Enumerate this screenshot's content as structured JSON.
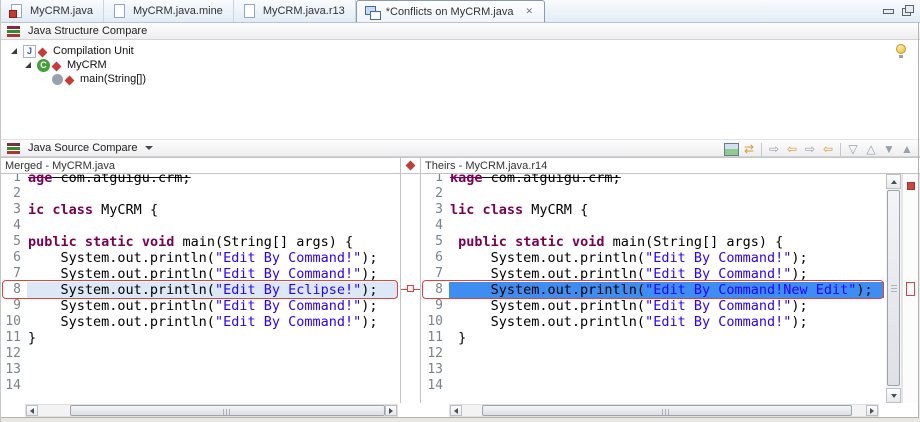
{
  "tabs": [
    {
      "label": "MyCRM.java",
      "icon": "java-file-error",
      "active": false
    },
    {
      "label": "MyCRM.java.mine",
      "icon": "file",
      "active": false
    },
    {
      "label": "MyCRM.java.r13",
      "icon": "file",
      "active": false
    },
    {
      "label": "*Conflicts on MyCRM.java",
      "icon": "compare-editor",
      "active": true,
      "close_glyph": "✕"
    }
  ],
  "structure_compare": {
    "title": "Java Structure Compare",
    "items": [
      {
        "label": "Compilation Unit",
        "icon": "java-cu",
        "glyph": "J",
        "level": 0,
        "expanded": true,
        "marker": "conflict"
      },
      {
        "label": "MyCRM",
        "icon": "class",
        "glyph": "C",
        "level": 1,
        "expanded": true,
        "marker": "conflict"
      },
      {
        "label": "main(String[])",
        "icon": "method",
        "glyph": "",
        "level": 2,
        "expanded": null,
        "marker": "conflict"
      }
    ]
  },
  "source_compare": {
    "title": "Java Source Compare",
    "toolbar": [
      {
        "name": "switch-compare-viewer",
        "glyph": "",
        "cls": "layout"
      },
      {
        "name": "swap-left-and-right",
        "glyph": "⇄",
        "cls": "gold"
      },
      {
        "sep": true
      },
      {
        "name": "copy-all-from-left-to-right",
        "glyph": "⇨",
        "cls": ""
      },
      {
        "name": "copy-all-non-conflicting-from-right-to-left",
        "glyph": "⇦",
        "cls": "gold"
      },
      {
        "name": "copy-current-change-from-left-to-right",
        "glyph": "⇨",
        "cls": ""
      },
      {
        "name": "copy-current-change-from-right-to-left",
        "glyph": "⇦",
        "cls": "gold"
      },
      {
        "sep": true
      },
      {
        "name": "next-difference",
        "glyph": "▽",
        "cls": ""
      },
      {
        "name": "previous-difference",
        "glyph": "△",
        "cls": ""
      },
      {
        "name": "next-change",
        "glyph": "▼",
        "cls": ""
      },
      {
        "name": "previous-change",
        "glyph": "▲",
        "cls": ""
      }
    ],
    "left": {
      "title": "Merged - MyCRM.java",
      "total_lines": 14,
      "lines": [
        {
          "strike": true,
          "segs": [
            [
              "age",
              "k"
            ],
            [
              " com.atguigu.crm;",
              "p"
            ]
          ]
        },
        {
          "segs": []
        },
        {
          "segs": [
            [
              "ic",
              "k"
            ],
            [
              " ",
              "p"
            ],
            [
              "class",
              "k"
            ],
            [
              " MyCRM {",
              "p"
            ]
          ]
        },
        {
          "segs": []
        },
        {
          "segs": [
            [
              "public",
              "k"
            ],
            [
              " ",
              "p"
            ],
            [
              "static",
              "k"
            ],
            [
              " ",
              "p"
            ],
            [
              "void",
              "k"
            ],
            [
              " main(String[] args) {",
              "p"
            ]
          ]
        },
        {
          "segs": [
            [
              "    System.out.println(",
              "p"
            ],
            [
              "\"Edit By Command!\"",
              "s"
            ],
            [
              ");",
              "p"
            ]
          ]
        },
        {
          "segs": [
            [
              "    System.out.println(",
              "p"
            ],
            [
              "\"Edit By Command!\"",
              "s"
            ],
            [
              ");",
              "p"
            ]
          ]
        },
        {
          "diff": true,
          "segs": [
            [
              "    System.out.println(",
              "p"
            ],
            [
              "\"Edit By Eclipse!\"",
              "s"
            ],
            [
              ");",
              "p"
            ]
          ]
        },
        {
          "segs": [
            [
              "    System.out.println(",
              "p"
            ],
            [
              "\"Edit By Command!\"",
              "s"
            ],
            [
              ");",
              "p"
            ]
          ]
        },
        {
          "segs": [
            [
              "    System.out.println(",
              "p"
            ],
            [
              "\"Edit By Command!\"",
              "s"
            ],
            [
              ");",
              "p"
            ]
          ]
        },
        {
          "segs": [
            [
              "}",
              "p"
            ]
          ]
        },
        {
          "segs": []
        },
        {
          "segs": []
        },
        {
          "segs": []
        }
      ]
    },
    "right": {
      "title": "Theirs - MyCRM.java.r14",
      "total_lines": 14,
      "lines": [
        {
          "strike": true,
          "segs": [
            [
              "kage",
              "k"
            ],
            [
              " com.atguigu.crm;",
              "p"
            ]
          ]
        },
        {
          "segs": []
        },
        {
          "segs": [
            [
              "lic",
              "k"
            ],
            [
              " ",
              "p"
            ],
            [
              "class",
              "k"
            ],
            [
              " MyCRM {",
              "p"
            ]
          ]
        },
        {
          "segs": []
        },
        {
          "segs": [
            [
              " ",
              "p"
            ],
            [
              "public",
              "k"
            ],
            [
              " ",
              "p"
            ],
            [
              "static",
              "k"
            ],
            [
              " ",
              "p"
            ],
            [
              "void",
              "k"
            ],
            [
              " main(String[] args) {",
              "p"
            ]
          ]
        },
        {
          "segs": [
            [
              "     System.out.println(",
              "p"
            ],
            [
              "\"Edit By Command!\"",
              "s"
            ],
            [
              ");",
              "p"
            ]
          ]
        },
        {
          "segs": [
            [
              "     System.out.println(",
              "p"
            ],
            [
              "\"Edit By Command!\"",
              "s"
            ],
            [
              ");",
              "p"
            ]
          ]
        },
        {
          "diff": true,
          "selected": true,
          "segs": [
            [
              "     System.out.println(",
              "p"
            ],
            [
              "\"Edit By Command!New Edit\"",
              "s"
            ],
            [
              ");",
              "p"
            ]
          ]
        },
        {
          "segs": [
            [
              "     System.out.println(",
              "p"
            ],
            [
              "\"Edit By Command!\"",
              "s"
            ],
            [
              ");",
              "p"
            ]
          ]
        },
        {
          "segs": [
            [
              "     System.out.println(",
              "p"
            ],
            [
              "\"Edit By Command!\"",
              "s"
            ],
            [
              ");",
              "p"
            ]
          ]
        },
        {
          "segs": [
            [
              " }",
              "p"
            ]
          ]
        },
        {
          "segs": []
        },
        {
          "segs": []
        },
        {
          "segs": []
        }
      ]
    }
  },
  "colors": {
    "selection_blue": "#3E8DF0",
    "diff_highlight": "#DCE8F6",
    "conflict_red": "#E0433C",
    "keyword": "#7B0052",
    "string": "#2A00FF",
    "line_number": "#7A838D"
  }
}
